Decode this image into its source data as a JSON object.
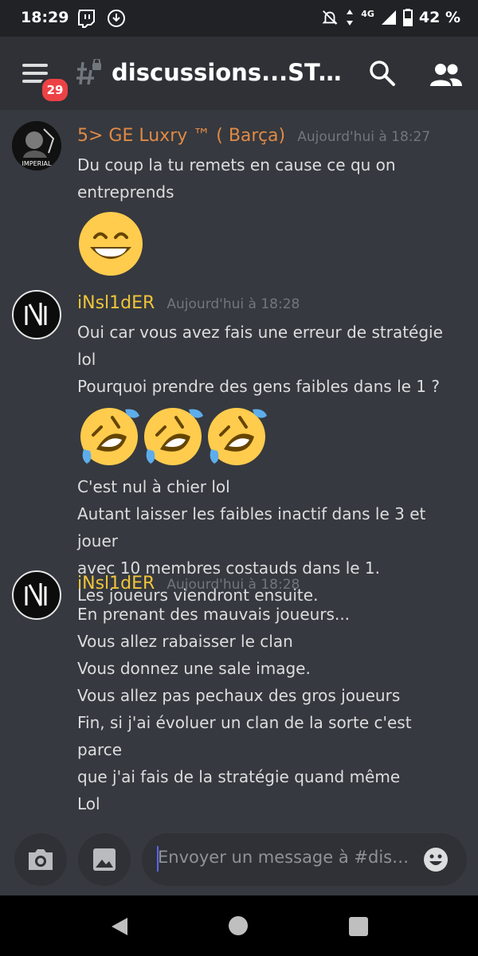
{
  "status_bar": {
    "time": "18:29",
    "network": "4G",
    "battery": "42 %"
  },
  "app_bar": {
    "channel_name": "discussions...STAF...",
    "unread_badge": "29"
  },
  "messages": [
    {
      "author": "5> GE Luxry ™ ( Barça)",
      "timestamp": "Aujourd'hui à 18:27",
      "avatar_text": "IMPERIAL",
      "lines": [
        "Du coup la tu remets en cause ce qu on",
        "entreprends"
      ],
      "emojis": [
        "grinning-face-with-smiling-eyes"
      ]
    },
    {
      "author": "iNsl1dER",
      "timestamp": "Aujourd'hui à 18:28",
      "avatar_text": "N",
      "lines_before": [
        "Oui car vous avez fais une erreur de stratégie lol",
        "Pourquoi prendre des gens faibles dans le 1 ?"
      ],
      "emojis": [
        "rolling-on-the-floor-laughing",
        "rolling-on-the-floor-laughing",
        "rolling-on-the-floor-laughing"
      ],
      "lines_after": [
        "C'est nul à chier lol",
        "Autant laisser les faibles inactif dans le 3 et jouer",
        "avec 10 membres costauds dans le 1.",
        "Les joueurs viendront ensuite."
      ]
    },
    {
      "author": "iNsl1dER",
      "timestamp": "Aujourd'hui à 18:28",
      "avatar_text": "N",
      "lines": [
        "En prenant des mauvais joueurs...",
        "Vous allez rabaisser le clan",
        "Vous donnez une sale image.",
        "Vous allez pas pechaux des gros joueurs",
        "Fin, si j'ai évoluer un clan de la sorte c'est parce",
        "que j'ai fais de la stratégie quand même",
        "Lol"
      ]
    }
  ],
  "composer": {
    "placeholder": "Envoyer un message à #discu..."
  },
  "colors": {
    "background": "#36393f",
    "header": "#2f3136",
    "author_1": "#e08a45",
    "author_2": "#f0c43a",
    "badge": "#ed4245"
  }
}
